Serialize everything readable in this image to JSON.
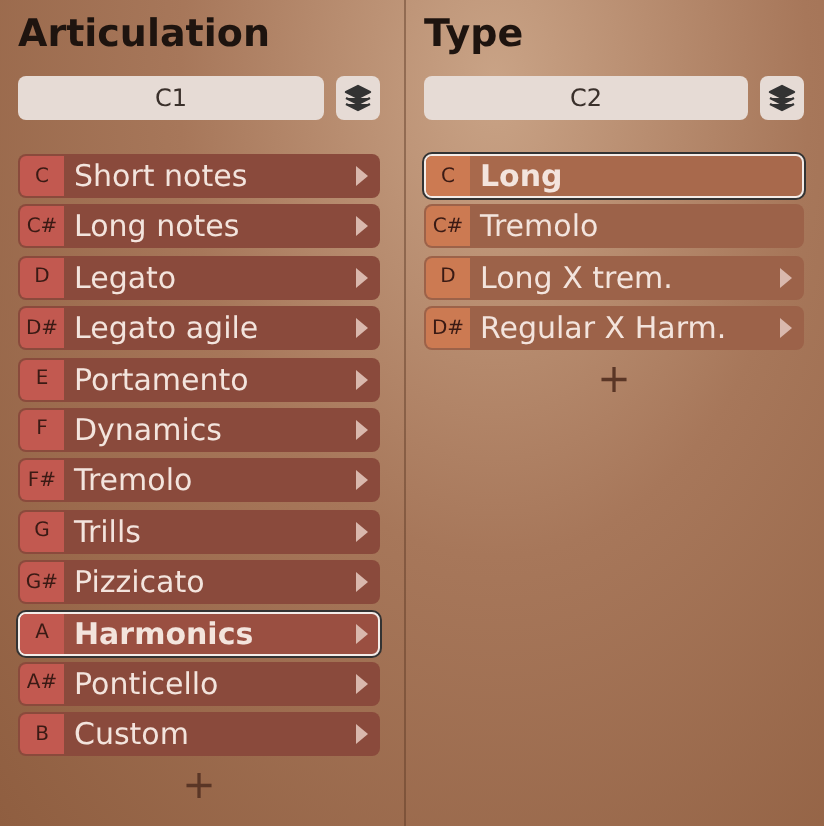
{
  "columns": [
    {
      "title": "Articulation",
      "key_field": "C1",
      "add": "+",
      "items": [
        {
          "key": "C",
          "label": "Short notes",
          "submenu": true,
          "selected": false
        },
        {
          "key": "C#",
          "label": "Long notes",
          "submenu": true,
          "selected": false
        },
        {
          "key": "D",
          "label": "Legato",
          "submenu": true,
          "selected": false
        },
        {
          "key": "D#",
          "label": "Legato agile",
          "submenu": true,
          "selected": false
        },
        {
          "key": "E",
          "label": "Portamento",
          "submenu": true,
          "selected": false
        },
        {
          "key": "F",
          "label": "Dynamics",
          "submenu": true,
          "selected": false
        },
        {
          "key": "F#",
          "label": "Tremolo",
          "submenu": true,
          "selected": false
        },
        {
          "key": "G",
          "label": "Trills",
          "submenu": true,
          "selected": false
        },
        {
          "key": "G#",
          "label": "Pizzicato",
          "submenu": true,
          "selected": false
        },
        {
          "key": "A",
          "label": "Harmonics",
          "submenu": true,
          "selected": true
        },
        {
          "key": "A#",
          "label": "Ponticello",
          "submenu": true,
          "selected": false
        },
        {
          "key": "B",
          "label": "Custom",
          "submenu": true,
          "selected": false
        }
      ]
    },
    {
      "title": "Type",
      "key_field": "C2",
      "add": "+",
      "items": [
        {
          "key": "C",
          "label": "Long",
          "submenu": false,
          "selected": true
        },
        {
          "key": "C#",
          "label": "Tremolo",
          "submenu": false,
          "selected": false
        },
        {
          "key": "D",
          "label": "Long X trem.",
          "submenu": true,
          "selected": false
        },
        {
          "key": "D#",
          "label": "Regular X Harm.",
          "submenu": true,
          "selected": false
        }
      ]
    }
  ]
}
